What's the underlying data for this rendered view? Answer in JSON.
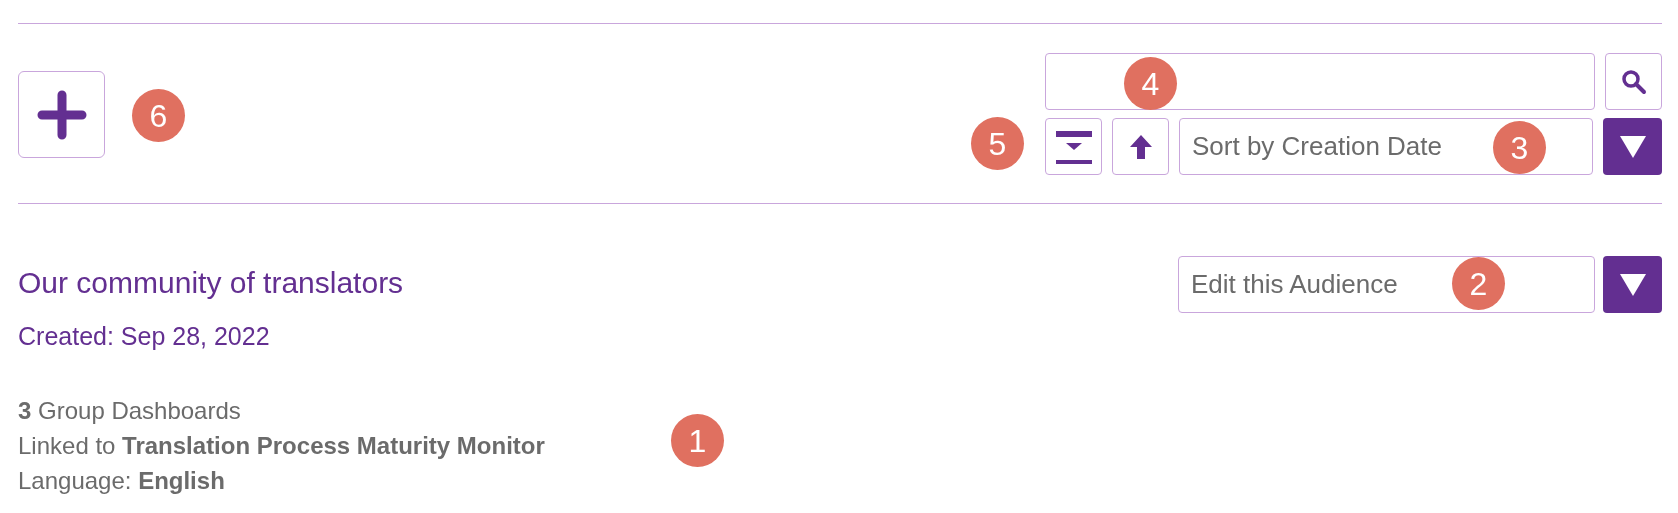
{
  "toolbar": {
    "sort": {
      "value": "Sort by Creation Date"
    }
  },
  "audience": {
    "title": "Our community of translators",
    "created": "Created: Sep 28, 2022",
    "action": {
      "value": "Edit this Audience"
    },
    "details": [
      "**3** Group Dashboards",
      "Linked to **Translation Process Maturity Monitor**",
      "Language: **English**"
    ]
  },
  "annotations": [
    {
      "label": "1"
    },
    {
      "label": "2"
    },
    {
      "label": "3"
    },
    {
      "label": "4"
    },
    {
      "label": "5"
    },
    {
      "label": "6"
    }
  ]
}
